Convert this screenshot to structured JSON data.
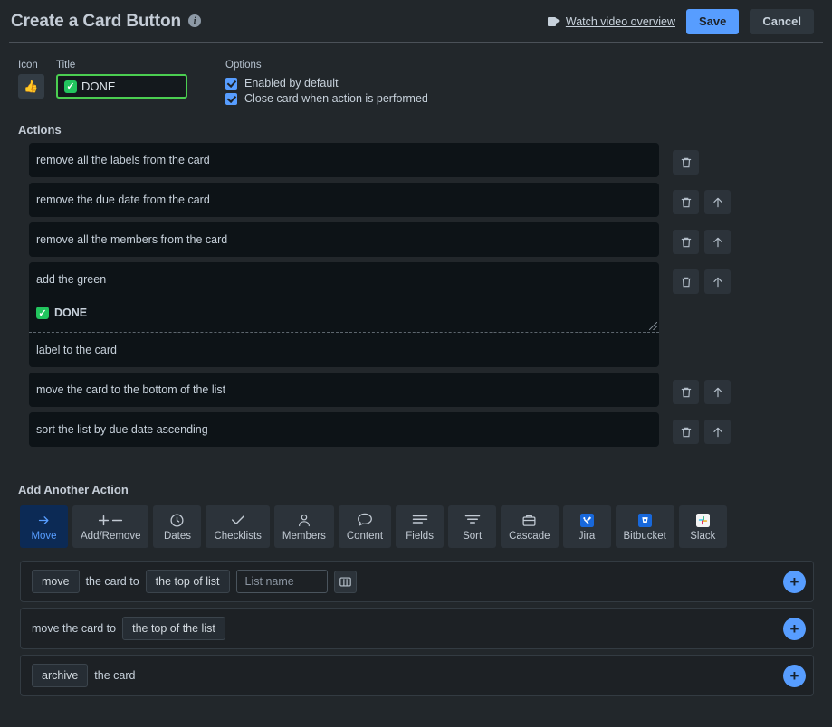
{
  "header": {
    "title": "Create a Card Button",
    "info_icon": "info-icon",
    "video_link": "Watch video overview",
    "save_label": "Save",
    "cancel_label": "Cancel"
  },
  "meta": {
    "icon_label": "Icon",
    "icon_glyph": "👍",
    "title_label": "Title",
    "title_value": "DONE",
    "title_check": "✓",
    "options_label": "Options",
    "options": [
      {
        "label": "Enabled by default",
        "checked": true
      },
      {
        "label": "Close card when action is performed",
        "checked": true
      }
    ]
  },
  "actions_section": {
    "heading": "Actions",
    "items": [
      {
        "text": "remove all the labels from the card",
        "has_delete": true,
        "has_up": false
      },
      {
        "text": "remove the due date from the card",
        "has_delete": true,
        "has_up": true
      },
      {
        "text": "remove all the members from the card",
        "has_delete": true,
        "has_up": true
      },
      {
        "text": "add the green",
        "mid_text": "DONE",
        "tail_text": "label to the card",
        "compound": true,
        "has_delete": true,
        "has_up": true
      },
      {
        "text": "move the card to the bottom of the list",
        "has_delete": true,
        "has_up": true
      },
      {
        "text": "sort the list by due date ascending",
        "has_delete": true,
        "has_up": true
      }
    ]
  },
  "add_another": {
    "heading": "Add Another Action",
    "tabs": [
      {
        "label": "Move",
        "icon": "arrow-right-icon",
        "active": true
      },
      {
        "label": "Add/Remove",
        "icon": "plus-minus-icon",
        "active": false
      },
      {
        "label": "Dates",
        "icon": "clock-icon",
        "active": false
      },
      {
        "label": "Checklists",
        "icon": "check-icon",
        "active": false
      },
      {
        "label": "Members",
        "icon": "person-icon",
        "active": false
      },
      {
        "label": "Content",
        "icon": "comment-icon",
        "active": false
      },
      {
        "label": "Fields",
        "icon": "lines-icon",
        "active": false
      },
      {
        "label": "Sort",
        "icon": "funnel-icon",
        "active": false
      },
      {
        "label": "Cascade",
        "icon": "briefcase-icon",
        "active": false
      },
      {
        "label": "Jira",
        "icon": "jira-icon",
        "active": false
      },
      {
        "label": "Bitbucket",
        "icon": "bitbucket-icon",
        "active": false
      },
      {
        "label": "Slack",
        "icon": "slack-icon",
        "active": false
      }
    ],
    "builder_rows": [
      {
        "pill1": "move",
        "text1": "the card to",
        "pill2": "the top of list",
        "input_placeholder": "List name",
        "input_value": "",
        "has_board_picker": true,
        "add_label": "+"
      },
      {
        "text1": "move the card to",
        "pill2": "the top of the list",
        "add_label": "+"
      },
      {
        "pill1": "archive",
        "text1": "the card",
        "add_label": "+"
      }
    ]
  },
  "colors": {
    "page_bg": "#22272b",
    "row_bg": "#0d1317",
    "accent": "#579dff",
    "accent_active_bg": "#0c2a55",
    "green": "#4bce51",
    "panel_bg": "#1d2125"
  }
}
